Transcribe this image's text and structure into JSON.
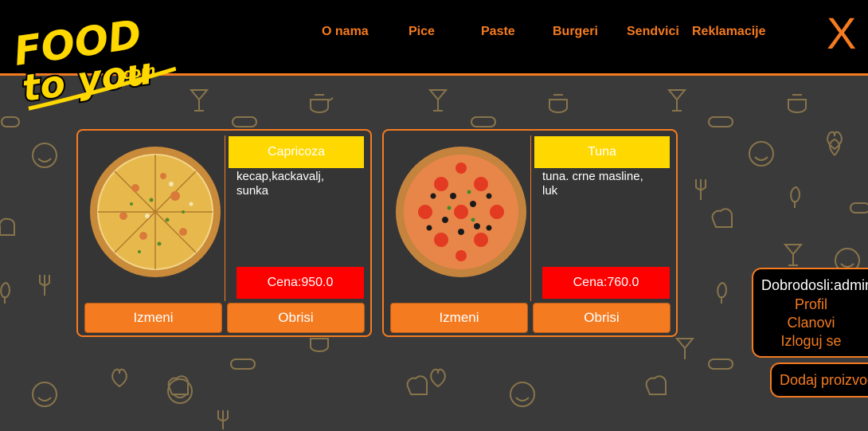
{
  "brand": {
    "line1": "FOOD",
    "line2": "to you",
    "suffix": ".com"
  },
  "nav": {
    "items": [
      {
        "label": "O nama"
      },
      {
        "label": "Pice"
      },
      {
        "label": "Paste"
      },
      {
        "label": "Burgeri"
      },
      {
        "label": "Sendvici"
      },
      {
        "label": "Reklamacije"
      }
    ],
    "close_label": "X"
  },
  "products": [
    {
      "name": "Capricoza",
      "description": "kecap,kackavalj, sunka",
      "price": "Cena:950.0",
      "edit_label": "Izmeni",
      "delete_label": "Obrisi",
      "image_icon": "pizza-capricciosa"
    },
    {
      "name": "Tuna",
      "description": "tuna. crne masline, luk",
      "price": "Cena:760.0",
      "edit_label": "Izmeni",
      "delete_label": "Obrisi",
      "image_icon": "pizza-tuna"
    }
  ],
  "user_panel": {
    "welcome": "Dobrodosli:admin",
    "links": [
      {
        "label": "Profil"
      },
      {
        "label": "Clanovi"
      },
      {
        "label": "Izloguj se"
      }
    ]
  },
  "add_product": {
    "label": "Dodaj proizvod"
  },
  "colors": {
    "accent": "#f47b20",
    "name_bg": "#ffd800",
    "price_bg": "#ff0000",
    "header_bg": "#000000",
    "page_bg": "#3a3a3a"
  }
}
